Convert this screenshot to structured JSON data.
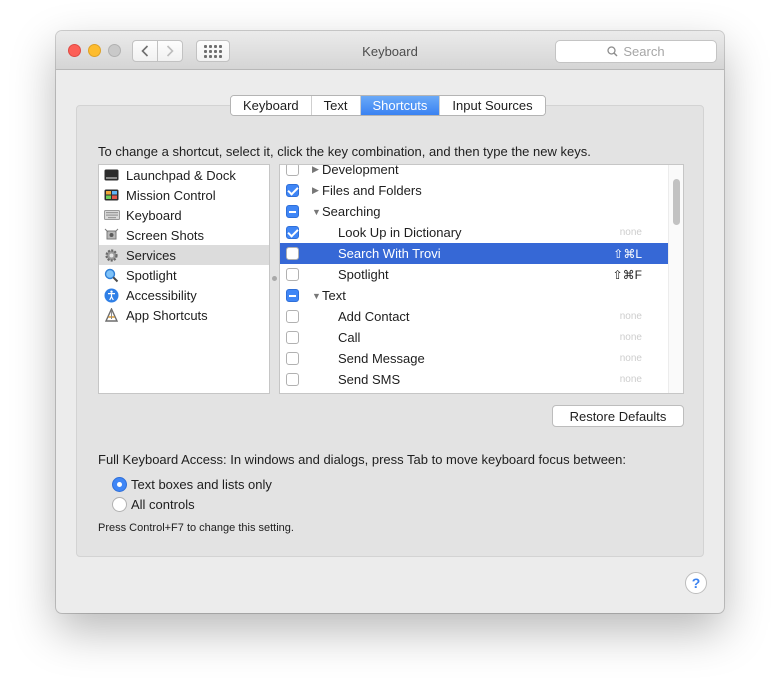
{
  "window": {
    "title": "Keyboard",
    "search_placeholder": "Search"
  },
  "tabs": [
    {
      "label": "Keyboard",
      "active": false
    },
    {
      "label": "Text",
      "active": false
    },
    {
      "label": "Shortcuts",
      "active": true
    },
    {
      "label": "Input Sources",
      "active": false
    }
  ],
  "instruction": "To change a shortcut, select it, click the key combination, and then type the new keys.",
  "categories": [
    {
      "label": "Launchpad & Dock",
      "icon": "launchpad-icon",
      "selected": false
    },
    {
      "label": "Mission Control",
      "icon": "mission-control-icon",
      "selected": false
    },
    {
      "label": "Keyboard",
      "icon": "keyboard-icon",
      "selected": false
    },
    {
      "label": "Screen Shots",
      "icon": "screenshot-icon",
      "selected": false
    },
    {
      "label": "Services",
      "icon": "gear-icon",
      "selected": true
    },
    {
      "label": "Spotlight",
      "icon": "spotlight-icon",
      "selected": false
    },
    {
      "label": "Accessibility",
      "icon": "accessibility-icon",
      "selected": false
    },
    {
      "label": "App Shortcuts",
      "icon": "app-shortcuts-icon",
      "selected": false
    }
  ],
  "services": [
    {
      "label": "Development",
      "check": "unchecked",
      "group": true,
      "expanded": false,
      "shortcut": ""
    },
    {
      "label": "Files and Folders",
      "check": "checked",
      "group": true,
      "expanded": false,
      "shortcut": ""
    },
    {
      "label": "Searching",
      "check": "mixed",
      "group": true,
      "expanded": true,
      "shortcut": ""
    },
    {
      "label": "Look Up in Dictionary",
      "check": "checked",
      "group": false,
      "shortcut": "none"
    },
    {
      "label": "Search With Trovi",
      "check": "unchecked",
      "group": false,
      "shortcut": "⇧⌘L",
      "selected": true
    },
    {
      "label": "Spotlight",
      "check": "unchecked",
      "group": false,
      "shortcut": "⇧⌘F"
    },
    {
      "label": "Text",
      "check": "mixed",
      "group": true,
      "expanded": true,
      "shortcut": ""
    },
    {
      "label": "Add Contact",
      "check": "unchecked",
      "group": false,
      "shortcut": "none"
    },
    {
      "label": "Call",
      "check": "unchecked",
      "group": false,
      "shortcut": "none"
    },
    {
      "label": "Send Message",
      "check": "unchecked",
      "group": false,
      "shortcut": "none"
    },
    {
      "label": "Send SMS",
      "check": "unchecked",
      "group": false,
      "shortcut": "none"
    }
  ],
  "restore_defaults_label": "Restore Defaults",
  "full_keyboard_access": {
    "label": "Full Keyboard Access: In windows and dialogs, press Tab to move keyboard focus between:",
    "options": [
      {
        "label": "Text boxes and lists only",
        "selected": true
      },
      {
        "label": "All controls",
        "selected": false
      }
    ],
    "hint": "Press Control+F7 to change this setting."
  },
  "help_label": "?"
}
